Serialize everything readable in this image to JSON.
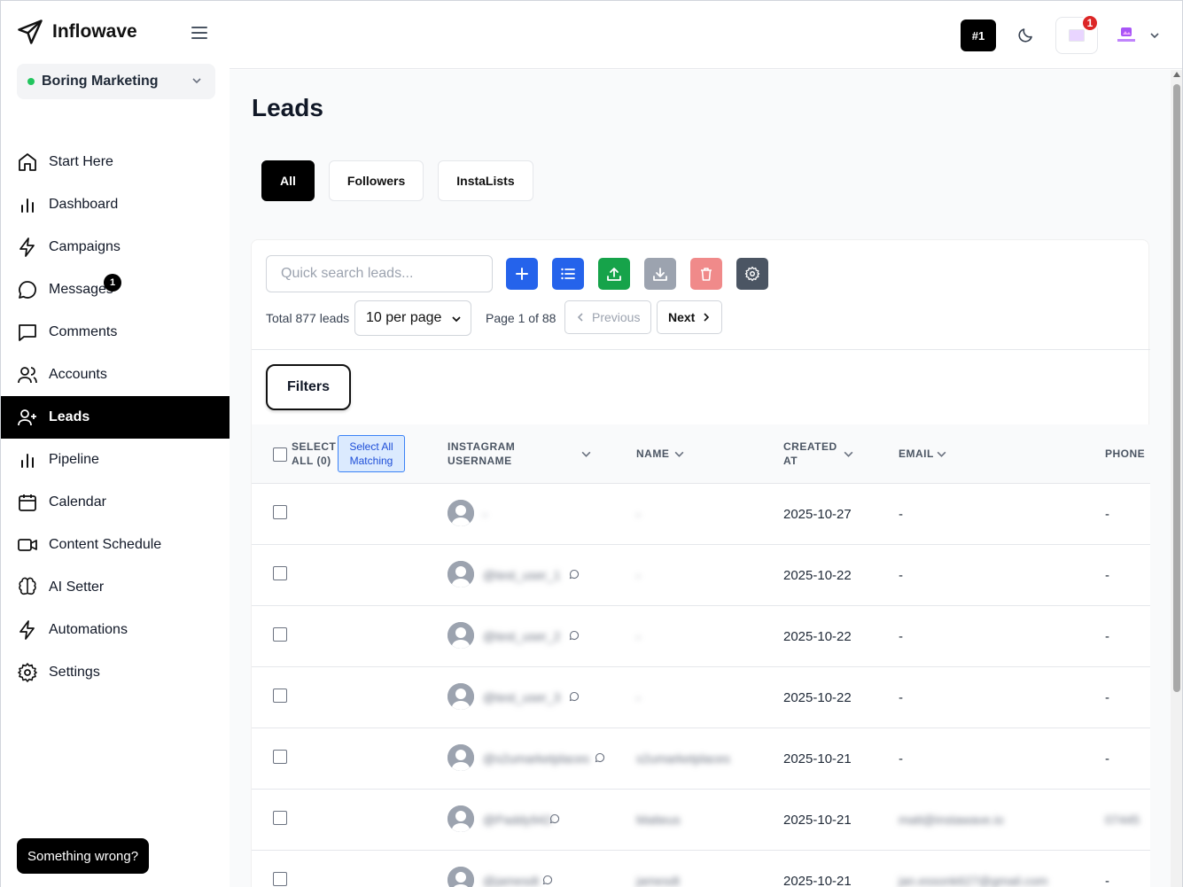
{
  "app": {
    "name": "Inflowave"
  },
  "workspace": {
    "name": "Boring Marketing"
  },
  "nav": [
    {
      "label": "Start Here",
      "icon": "home-icon"
    },
    {
      "label": "Dashboard",
      "icon": "bar-chart-icon"
    },
    {
      "label": "Campaigns",
      "icon": "lightning-icon"
    },
    {
      "label": "Messages",
      "icon": "message-circle-icon",
      "badge": "1"
    },
    {
      "label": "Comments",
      "icon": "comment-square-icon"
    },
    {
      "label": "Accounts",
      "icon": "users-icon"
    },
    {
      "label": "Leads",
      "icon": "user-plus-icon",
      "active": true
    },
    {
      "label": "Pipeline",
      "icon": "bar-chart-icon"
    },
    {
      "label": "Calendar",
      "icon": "calendar-icon"
    },
    {
      "label": "Content Schedule",
      "icon": "video-icon"
    },
    {
      "label": "AI Setter",
      "icon": "brain-icon"
    },
    {
      "label": "Automations",
      "icon": "lightning-icon"
    },
    {
      "label": "Settings",
      "icon": "gear-icon"
    }
  ],
  "feedback_button": "Something wrong?",
  "header": {
    "rank": "#1",
    "notif_count": "1"
  },
  "page": {
    "title": "Leads"
  },
  "tabs": [
    {
      "label": "All",
      "active": true
    },
    {
      "label": "Followers"
    },
    {
      "label": "InstaLists"
    }
  ],
  "search": {
    "placeholder": "Quick search leads..."
  },
  "toolbar_colors": {
    "add": "#2563eb",
    "list": "#2563eb",
    "upload": "#16a34a",
    "download": "#9ca3af",
    "delete": "#f08a8a",
    "settings": "#4b5563"
  },
  "pager": {
    "total": "Total 877 leads",
    "per_page": "10 per page",
    "page": "Page 1 of 88",
    "previous": "Previous",
    "next": "Next"
  },
  "filters_label": "Filters",
  "table": {
    "headers": {
      "select_all": "SELECT ALL (0)",
      "select_all_matching": "Select All Matching",
      "username": "INSTAGRAM USERNAME",
      "name": "NAME",
      "created": "CREATED AT",
      "email": "EMAIL",
      "phone": "PHONE"
    },
    "rows": [
      {
        "username": "-",
        "name": "-",
        "created": "2025-10-27",
        "email": "-",
        "phone": "-",
        "msg": false
      },
      {
        "username": "@test_user_1",
        "name": "-",
        "created": "2025-10-22",
        "email": "-",
        "phone": "-",
        "msg": true
      },
      {
        "username": "@test_user_2",
        "name": "-",
        "created": "2025-10-22",
        "email": "-",
        "phone": "-",
        "msg": true
      },
      {
        "username": "@test_user_3",
        "name": "-",
        "created": "2025-10-22",
        "email": "-",
        "phone": "-",
        "msg": true
      },
      {
        "username": "@s2umarketplaces",
        "name": "s2umarketplaces",
        "created": "2025-10-21",
        "email": "-",
        "phone": "-",
        "msg": true
      },
      {
        "username": "@Paddy942",
        "name": "Matteus",
        "created": "2025-10-21",
        "email": "matt@instawave.io",
        "phone": "07445",
        "msg": true
      },
      {
        "username": "@jamesdt",
        "name": "jamesdt",
        "created": "2025-10-21",
        "email": "jan.essonk627@gmail.com",
        "phone": "-",
        "msg": true
      }
    ]
  }
}
